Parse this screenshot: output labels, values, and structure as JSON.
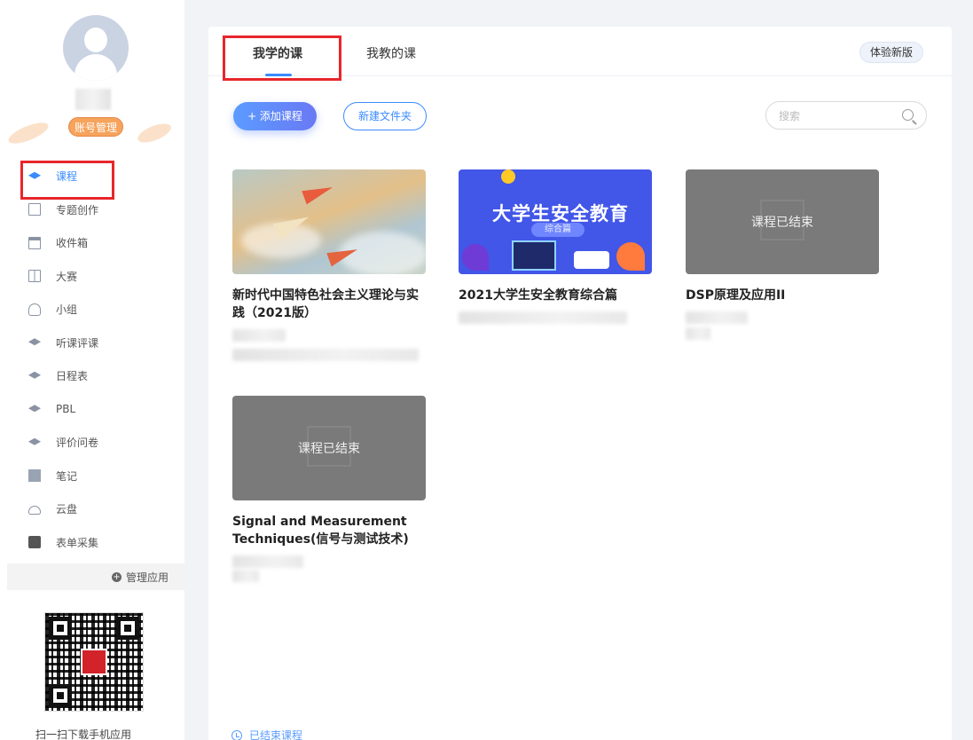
{
  "sidebar": {
    "account_button": "账号管理",
    "nav": [
      {
        "label": "课程",
        "icon": "graduation-cap-icon",
        "active": true
      },
      {
        "label": "专题创作",
        "icon": "window-icon"
      },
      {
        "label": "收件箱",
        "icon": "inbox-icon"
      },
      {
        "label": "大赛",
        "icon": "book-icon"
      },
      {
        "label": "小组",
        "icon": "group-icon"
      },
      {
        "label": "听课评课",
        "icon": "graduation-cap-icon"
      },
      {
        "label": "日程表",
        "icon": "graduation-cap-icon"
      },
      {
        "label": "PBL",
        "icon": "graduation-cap-icon"
      },
      {
        "label": "评价问卷",
        "icon": "graduation-cap-icon"
      },
      {
        "label": "笔记",
        "icon": "note-icon"
      },
      {
        "label": "云盘",
        "icon": "cloud-icon"
      },
      {
        "label": "表单采集",
        "icon": "video-icon"
      }
    ],
    "manage_apps": "管理应用",
    "qr_caption": "扫一扫下载手机应用"
  },
  "tabs": {
    "my_courses": "我学的课",
    "teaching_courses": "我教的课",
    "new_version": "体验新版"
  },
  "toolbar": {
    "add_course": "+ 添加课程",
    "new_folder": "新建文件夹",
    "search_placeholder": "搜索"
  },
  "courses": [
    {
      "title": "新时代中国特色社会主义理论与实践（2021版）",
      "status": ""
    },
    {
      "title": "2021大学生安全教育综合篇",
      "status": "",
      "banner_title": "大学生安全教育",
      "banner_tag": "综合篇"
    },
    {
      "title": "DSP原理及应用II",
      "status": "课程已结束"
    },
    {
      "title": "Signal and Measurement Techniques(信号与测试技术)",
      "status": "课程已结束"
    }
  ],
  "footer": {
    "ended_courses": "已结束课程"
  },
  "colors": {
    "accent": "#3a8bff",
    "highlight_box": "#e8262c",
    "account_button": "#f6a35c"
  }
}
